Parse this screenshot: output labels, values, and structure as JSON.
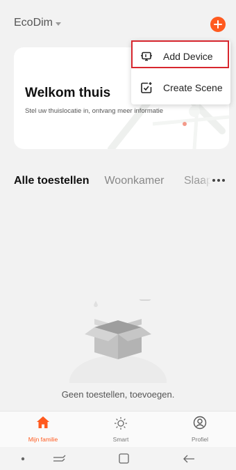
{
  "header": {
    "home_name": "EcoDim"
  },
  "welcome_card": {
    "title": "Welkom thuis",
    "subtitle": "Stel uw thuislocatie in, ontvang meer informatie"
  },
  "popup_menu": {
    "items": [
      {
        "label": "Add Device",
        "icon": "add-device-icon",
        "highlighted": true
      },
      {
        "label": "Create Scene",
        "icon": "create-scene-icon",
        "highlighted": false
      }
    ],
    "highlight_color": "#d7262e"
  },
  "tabs": {
    "items": [
      "Alle toestellen",
      "Woonkamer",
      "Slaap"
    ],
    "active_index": 0
  },
  "empty_state": {
    "message": "Geen toestellen, toevoegen."
  },
  "bottom_nav": {
    "items": [
      {
        "label": "Mijn familie",
        "icon": "home-icon",
        "active": true
      },
      {
        "label": "Smart",
        "icon": "sun-icon",
        "active": false
      },
      {
        "label": "Profiel",
        "icon": "profile-icon",
        "active": false
      }
    ]
  },
  "colors": {
    "accent": "#ff5a1f",
    "background": "#f2f2f2"
  }
}
